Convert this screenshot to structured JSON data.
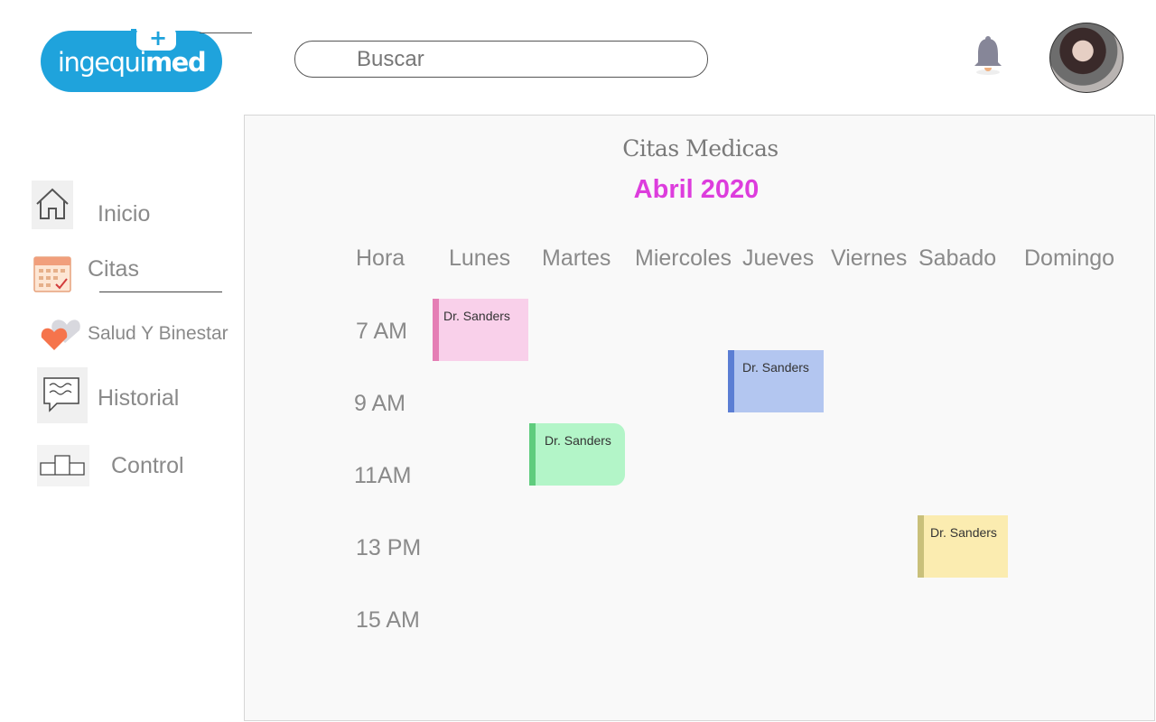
{
  "brand": {
    "logo_text_light": "ingequi",
    "logo_text_bold": "med"
  },
  "search": {
    "placeholder": "Buscar"
  },
  "header": {
    "notification_icon": "bell-icon",
    "avatar_icon": "user-avatar"
  },
  "sidebar": {
    "items": [
      {
        "label": "Inicio",
        "icon": "home-icon"
      },
      {
        "label": "Citas",
        "icon": "calendar-icon"
      },
      {
        "label": "Salud Y Binestar",
        "icon": "heart-icon"
      },
      {
        "label": "Historial",
        "icon": "chat-icon"
      },
      {
        "label": "Control",
        "icon": "podium-icon"
      }
    ]
  },
  "calendar": {
    "title": "Citas Medicas",
    "month": "Abril 2020",
    "columns": [
      "Hora",
      "Lunes",
      "Martes",
      "Miercoles",
      "Jueves",
      "Viernes",
      "Sabado",
      "Domingo"
    ],
    "times": [
      "7 AM",
      "9 AM",
      "11AM",
      "13 PM",
      "15 AM"
    ],
    "appointments": [
      {
        "label": "Dr. Sanders",
        "day": "Lunes",
        "time": "7 AM",
        "color": "#f9d0ea",
        "accent": "#e57fb5"
      },
      {
        "label": "Dr. Sanders",
        "day": "Jueves",
        "time": "9 AM",
        "color": "#b3c6f0",
        "accent": "#5b7ed4"
      },
      {
        "label": "Dr. Sanders",
        "day": "Martes",
        "time": "11AM",
        "color": "#b3f5c8",
        "accent": "#5fcc7d"
      },
      {
        "label": "Dr. Sanders",
        "day": "Sabado",
        "time": "13 PM",
        "color": "#fbecb0",
        "accent": "#c9c07a"
      }
    ]
  },
  "colors": {
    "brand": "#1fa3dc",
    "month": "#dd3ddd",
    "panel_bg": "#f9f9f9"
  }
}
